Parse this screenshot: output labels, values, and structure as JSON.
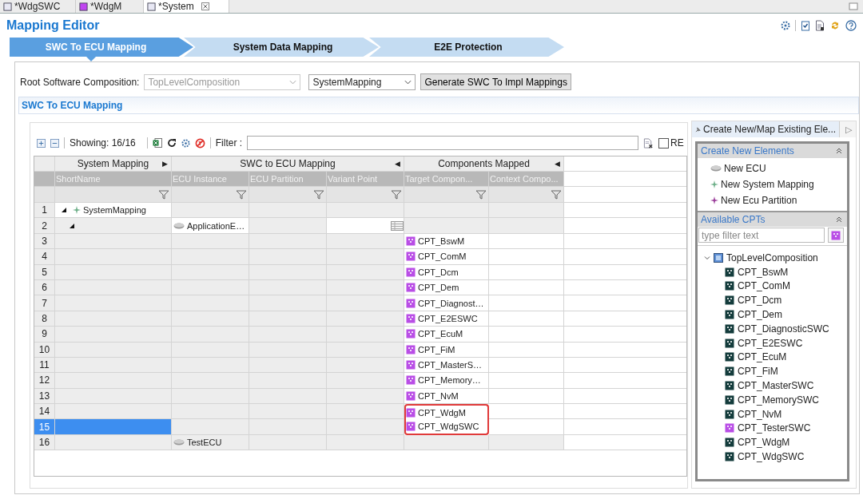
{
  "editor_tabs": [
    {
      "label": "*WdgSWC",
      "selected": false,
      "closable": false
    },
    {
      "label": "*WdgM",
      "selected": false,
      "closable": false
    },
    {
      "label": "*System",
      "selected": true,
      "closable": true
    }
  ],
  "title": "Mapping Editor",
  "steps": [
    {
      "label": "SWC To ECU Mapping",
      "selected": true
    },
    {
      "label": "System Data Mapping",
      "selected": false
    },
    {
      "label": "E2E Protection",
      "selected": false
    }
  ],
  "root_composition": {
    "label": "Root Software Composition:",
    "value": "TopLevelComposition",
    "disabled": true
  },
  "mapping_select": {
    "value": "SystemMapping",
    "disabled": false
  },
  "generate_button": "Generate SWC To Impl Mappings",
  "section_title": "SWC To ECU Mapping",
  "toolbar": {
    "showing": "Showing: 16/16",
    "filter_label": "Filter :",
    "regex_label": "RE",
    "regex_checked": false
  },
  "table": {
    "groups": [
      {
        "label": "System Mapping",
        "arrow": "▶",
        "columns": [
          "ShortName"
        ]
      },
      {
        "label": "SWC to ECU Mapping",
        "arrow": "◀",
        "columns": [
          "ECU Instance",
          "ECU Partition",
          "Variant Point"
        ]
      },
      {
        "label": "Components Mapped",
        "arrow": "◀",
        "columns": [
          "Target Compon...",
          "Context Compo..."
        ]
      }
    ],
    "rows": [
      {
        "num": "1",
        "short_name": "SystemMapping",
        "expanded": true,
        "selected": false,
        "highlighted": false,
        "children": [
          {
            "num": "2",
            "ecu_instance": "ApplicationE…",
            "variant_picker": true,
            "expanded": true,
            "selected": false,
            "highlighted": false,
            "children": [
              {
                "num": "3",
                "target": "CPT_BswM",
                "selected": false,
                "highlighted": false
              },
              {
                "num": "4",
                "target": "CPT_ComM",
                "selected": false,
                "highlighted": false
              },
              {
                "num": "5",
                "target": "CPT_Dcm",
                "selected": false,
                "highlighted": false
              },
              {
                "num": "6",
                "target": "CPT_Dem",
                "selected": false,
                "highlighted": false
              },
              {
                "num": "7",
                "target": "CPT_Diagnost…",
                "selected": false,
                "highlighted": false
              },
              {
                "num": "8",
                "target": "CPT_E2ESWC",
                "selected": false,
                "highlighted": false
              },
              {
                "num": "9",
                "target": "CPT_EcuM",
                "selected": false,
                "highlighted": false
              },
              {
                "num": "10",
                "target": "CPT_FiM",
                "selected": false,
                "highlighted": false
              },
              {
                "num": "11",
                "target": "CPT_MasterS…",
                "selected": false,
                "highlighted": false
              },
              {
                "num": "12",
                "target": "CPT_Memory…",
                "selected": false,
                "highlighted": false
              },
              {
                "num": "13",
                "target": "CPT_NvM",
                "selected": false,
                "highlighted": false
              },
              {
                "num": "14",
                "target": "CPT_WdgM",
                "selected": false,
                "highlighted": true
              },
              {
                "num": "15",
                "target": "CPT_WdgSWC",
                "selected": true,
                "highlighted": true
              }
            ]
          },
          {
            "num": "16",
            "ecu_instance": "TestECU",
            "selected": false,
            "highlighted": false
          }
        ]
      }
    ]
  },
  "palette": {
    "tab": "Create New/Map Existing Ele...",
    "arrow": "▷",
    "create_title": "Create New Elements",
    "create_items": [
      {
        "label": "New ECU",
        "kind": "ecu"
      },
      {
        "label": "New System Mapping",
        "kind": "mapping"
      },
      {
        "label": "New Ecu Partition",
        "kind": "partition"
      }
    ],
    "cpt_title": "Available CPTs",
    "filter_placeholder": "type filter text",
    "tree": {
      "label": "TopLevelComposition",
      "expanded": true,
      "children": [
        {
          "label": "CPT_BswM",
          "color": "#143c3c"
        },
        {
          "label": "CPT_ComM",
          "color": "#143c3c"
        },
        {
          "label": "CPT_Dcm",
          "color": "#143c3c"
        },
        {
          "label": "CPT_Dem",
          "color": "#143c3c"
        },
        {
          "label": "CPT_DiagnosticSWC",
          "color": "#143c3c"
        },
        {
          "label": "CPT_E2ESWC",
          "color": "#143c3c"
        },
        {
          "label": "CPT_EcuM",
          "color": "#143c3c"
        },
        {
          "label": "CPT_FiM",
          "color": "#143c3c"
        },
        {
          "label": "CPT_MasterSWC",
          "color": "#143c3c"
        },
        {
          "label": "CPT_MemorySWC",
          "color": "#143c3c"
        },
        {
          "label": "CPT_NvM",
          "color": "#143c3c"
        },
        {
          "label": "CPT_TesterSWC",
          "color": "#b94ee6"
        },
        {
          "label": "CPT_WdgM",
          "color": "#143c3c"
        },
        {
          "label": "CPT_WdgSWC",
          "color": "#143c3c"
        }
      ]
    }
  }
}
